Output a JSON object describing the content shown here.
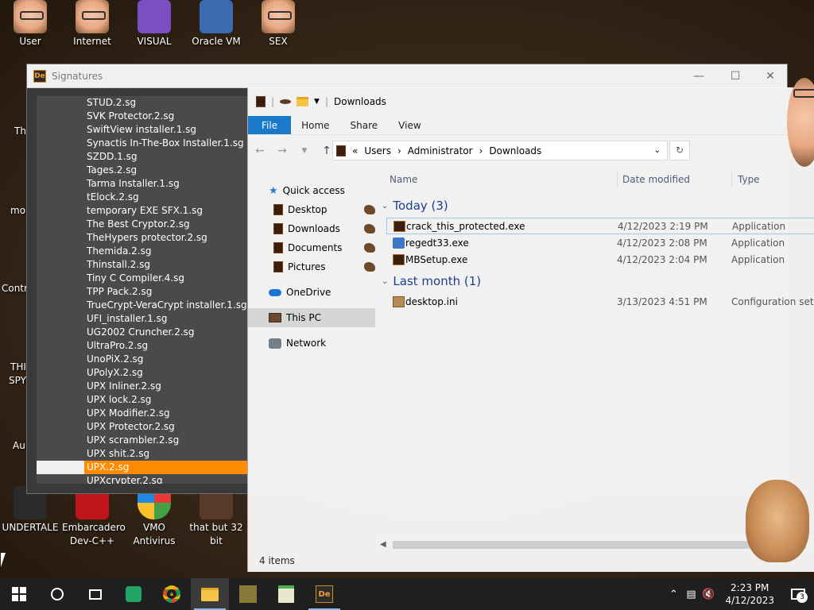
{
  "desktop": {
    "top_icons": [
      {
        "label": "User"
      },
      {
        "label": "Internet"
      },
      {
        "label": "VISUAL"
      },
      {
        "label": "Oracle VM"
      },
      {
        "label": "SEX"
      }
    ],
    "side_labels": [
      "Th",
      "mo",
      "Contr",
      "THI",
      "SPY",
      "Au"
    ],
    "bottom_icons": [
      {
        "label": "UNDERTALE"
      },
      {
        "label": "Embarcadero Dev-C++"
      },
      {
        "label": "VMO Antivirus"
      },
      {
        "label": "that but 32 bit"
      }
    ]
  },
  "sig_window": {
    "title": "Signatures",
    "items": [
      "STUD.2.sg",
      "SVK Protector.2.sg",
      "SwiftView installer.1.sg",
      "Synactis In-The-Box Installer.1.sg",
      "SZDD.1.sg",
      "Tages.2.sg",
      "Tarma Installer.1.sg",
      "tElock.2.sg",
      "temporary EXE SFX.1.sg",
      "The Best Cryptor.2.sg",
      "TheHypers protector.2.sg",
      "Themida.2.sg",
      "Thinstall.2.sg",
      "Tiny C Compiler.4.sg",
      "TPP Pack.2.sg",
      "TrueCrypt-VeraCrypt installer.1.sg",
      "UFI_installer.1.sg",
      "UG2002 Cruncher.2.sg",
      "UltraPro.2.sg",
      "UnoPiX.2.sg",
      "UPolyX.2.sg",
      "UPX Inliner.2.sg",
      "UPX lock.2.sg",
      "UPX Modifier.2.sg",
      "UPX Protector.2.sg",
      "UPX scrambler.2.sg",
      "UPX shit.2.sg",
      "UPX.2.sg",
      "UPXcrypter.2.sg"
    ],
    "selected_index": 27
  },
  "explorer": {
    "title": "Downloads",
    "tabs": {
      "file": "File",
      "home": "Home",
      "share": "Share",
      "view": "View"
    },
    "address": {
      "sep": "«",
      "parts": [
        "Users",
        "Administrator",
        "Downloads"
      ]
    },
    "nav": {
      "quick_access": "Quick access",
      "pinned": [
        "Desktop",
        "Downloads",
        "Documents",
        "Pictures"
      ],
      "onedrive": "OneDrive",
      "this_pc": "This PC",
      "network": "Network"
    },
    "columns": {
      "name": "Name",
      "date": "Date modified",
      "type": "Type"
    },
    "groups": [
      {
        "label": "Today (3)",
        "files": [
          {
            "name": "crack_this_protected.exe",
            "date": "4/12/2023 2:19 PM",
            "type": "Application"
          },
          {
            "name": "regedt33.exe",
            "date": "4/12/2023 2:08 PM",
            "type": "Application"
          },
          {
            "name": "MBSetup.exe",
            "date": "4/12/2023 2:04 PM",
            "type": "Application"
          }
        ]
      },
      {
        "label": "Last month (1)",
        "files": [
          {
            "name": "desktop.ini",
            "date": "3/13/2023 4:51 PM",
            "type": "Configuration set"
          }
        ]
      }
    ],
    "status": "4 items"
  },
  "taskbar": {
    "time": "2:23 PM",
    "date": "4/12/2023",
    "notifications": "3"
  },
  "colors": {
    "accent": "#1979ca",
    "selection": "#ff8c00",
    "group_header": "#1e3e8f",
    "taskbar": "#1f1f1f"
  }
}
